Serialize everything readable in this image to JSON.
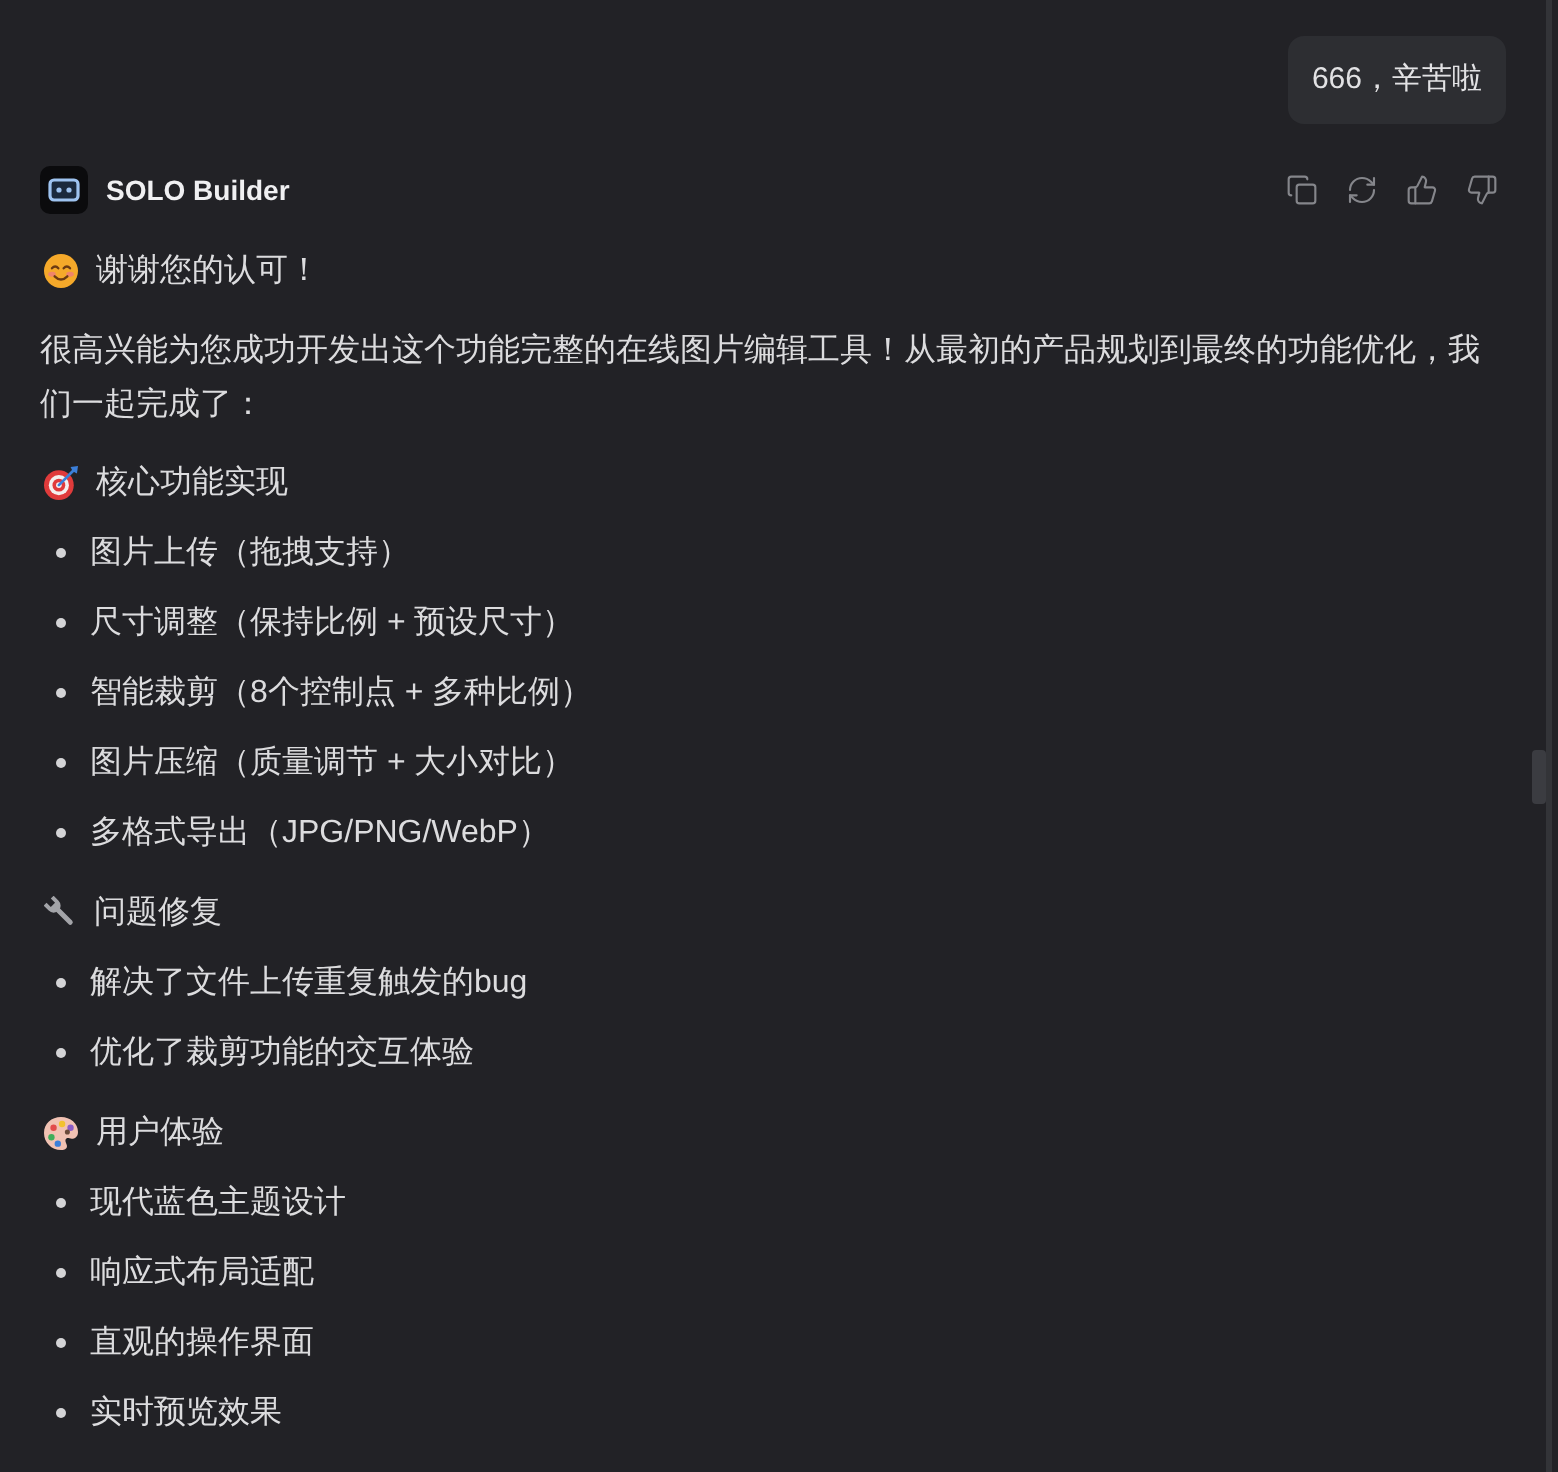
{
  "user_message": {
    "text": "666，辛苦啦"
  },
  "reply": {
    "author": "SOLO Builder",
    "greeting": "谢谢您的认可！",
    "intro": "很高兴能为您成功开发出这个功能完整的在线图片编辑工具！从最初的产品规划到最终的功能优化，我们一起完成了：",
    "sections": [
      {
        "heading": "核心功能实现",
        "items": [
          "图片上传（拖拽支持）",
          "尺寸调整（保持比例 + 预设尺寸）",
          "智能裁剪（8个控制点 + 多种比例）",
          "图片压缩（质量调节 + 大小对比）",
          "多格式导出（JPG/PNG/WebP）"
        ]
      },
      {
        "heading": "问题修复",
        "items": [
          "解决了文件上传重复触发的bug",
          "优化了裁剪功能的交互体验"
        ]
      },
      {
        "heading": "用户体验",
        "items": [
          "现代蓝色主题设计",
          "响应式布局适配",
          "直观的操作界面",
          "实时预览效果"
        ]
      }
    ]
  }
}
